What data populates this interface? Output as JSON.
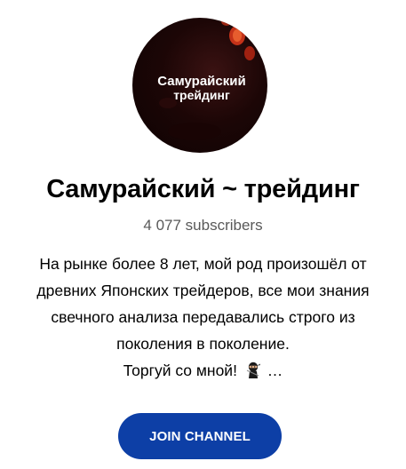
{
  "channel": {
    "avatar_text_line1": "Самурайский",
    "avatar_text_line2": "трейдинг",
    "title": "Самурайский ~ трейдинг",
    "subscribers": "4 077 subscribers",
    "description_lines": [
      "На рынке более 8 лет, мой род произошёл от",
      "древних Японских трейдеров, все мои знания",
      "свечного анализа передавались строго из",
      "поколения в поколение."
    ],
    "description_last_text": "Торгуй со мной!",
    "description_icon": "ninja-icon",
    "description_ellipsis": "…"
  },
  "actions": {
    "join_label": "JOIN CHANNEL"
  },
  "colors": {
    "button_bg": "#0d3fa6",
    "button_text": "#ffffff",
    "subscribers_text": "#595959",
    "avatar_bg": "#1c0606",
    "lantern": "#e0391c"
  }
}
